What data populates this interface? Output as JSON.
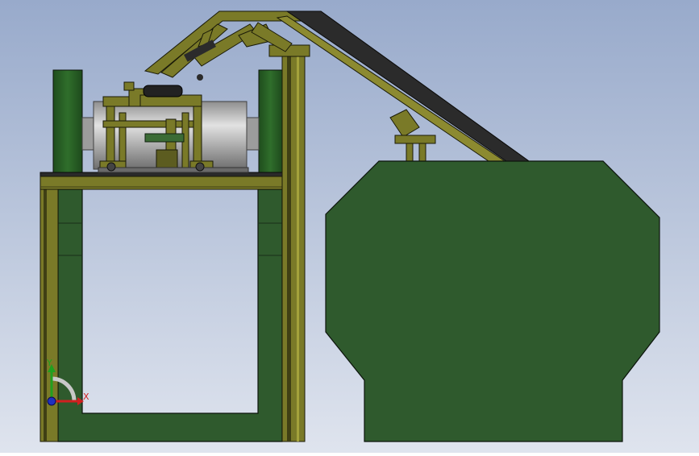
{
  "triad": {
    "x_label": "X",
    "y_label": "Y"
  },
  "colors": {
    "bg_top": "#9aaccb",
    "bg_bottom": "#dde3ee",
    "frame_green": "#2f5a2d",
    "frame_edge": "#0c140c",
    "steel": "#7a7a28",
    "steel_light": "#a4a23c",
    "steel_dark": "#3f3f14",
    "belt": "#2b2b2b",
    "drum": "#bdbdbd",
    "axis_x": "#d02020",
    "axis_y": "#20a020",
    "axis_z": "#2030c0"
  }
}
